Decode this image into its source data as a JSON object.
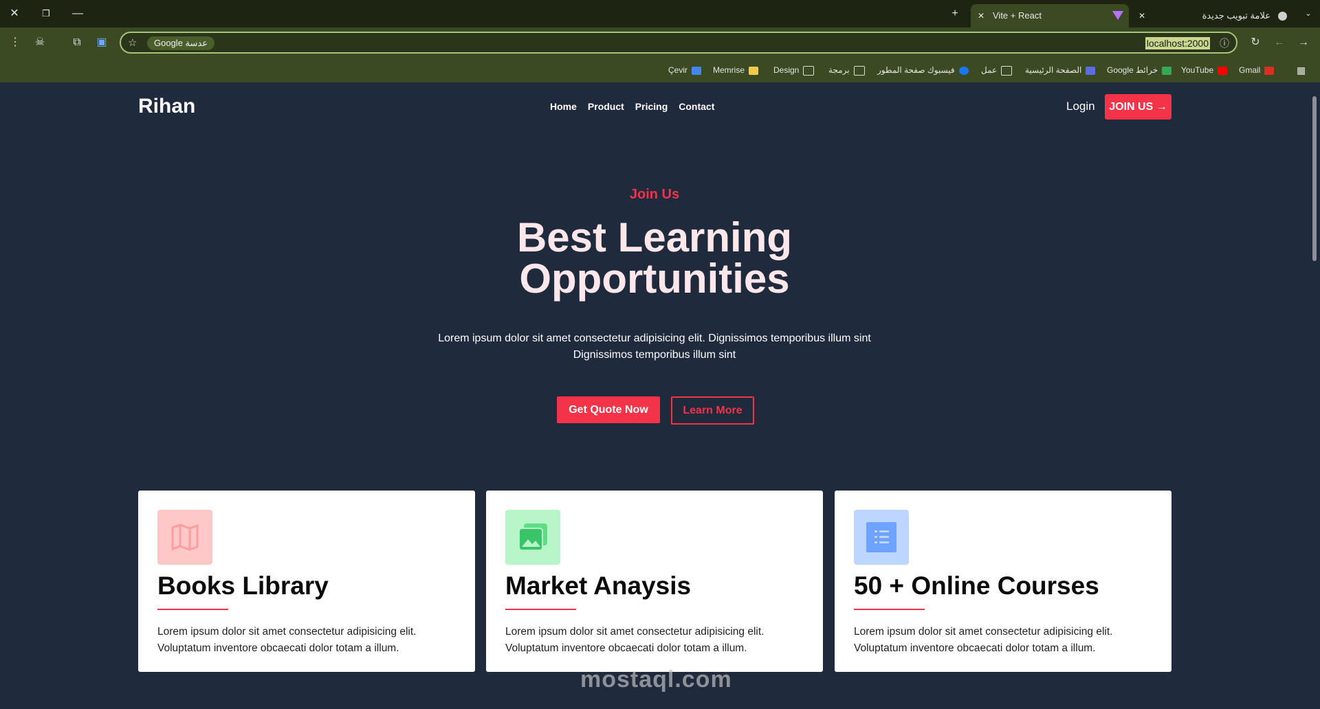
{
  "browser": {
    "tabs": [
      {
        "label": "Vite + React",
        "active": true
      },
      {
        "label": "علامة تبويب جديدة",
        "active": false
      }
    ],
    "lens_chip": "Google عدسة",
    "url": "localhost:2000",
    "bookmarks": [
      "Gmail",
      "YouTube",
      "Google خرائط",
      "الصفحة الرئيسية",
      "عمل",
      "فيسبوك صفحة المطور",
      "برمجة",
      "Design",
      "Memrise",
      "Çevir"
    ]
  },
  "site": {
    "brand": "Rihan",
    "nav": [
      "Home",
      "Product",
      "Pricing",
      "Contact"
    ],
    "login": "Login",
    "join_button": "JOIN US",
    "hero": {
      "eyebrow": "Join Us",
      "title_line1": "Best Learning",
      "title_line2": "Opportunities",
      "text_line1": "Lorem ipsum dolor sit amet consectetur adipisicing elit. Dignissimos temporibus illum sint",
      "text_line2": "Dignissimos temporibus illum sint",
      "primary_button": "Get Quote Now",
      "secondary_button": "Learn More"
    },
    "cards": [
      {
        "title": "Books Library",
        "text": "Lorem ipsum dolor sit amet consectetur adipisicing elit. Voluptatum inventore obcaecati dolor totam a illum.",
        "icon": "map-icon",
        "icon_bg": "#ffc8c8"
      },
      {
        "title": "Market Anaysis",
        "text": "Lorem ipsum dolor sit amet consectetur adipisicing elit. Voluptatum inventore obcaecati dolor totam a illum.",
        "icon": "images-icon",
        "icon_bg": "#b8f5c8"
      },
      {
        "title": "50 + Online Courses",
        "text": "Lorem ipsum dolor sit amet consectetur adipisicing elit. Voluptatum inventore obcaecati dolor totam a illum.",
        "icon": "list-icon",
        "icon_bg": "#bcd6ff"
      }
    ]
  },
  "watermark": "mostaql.com",
  "colors": {
    "accent": "#f43348",
    "page_bg": "#1f2a3d",
    "hero_title": "#fde7ea",
    "chrome": "#3b4a22"
  }
}
